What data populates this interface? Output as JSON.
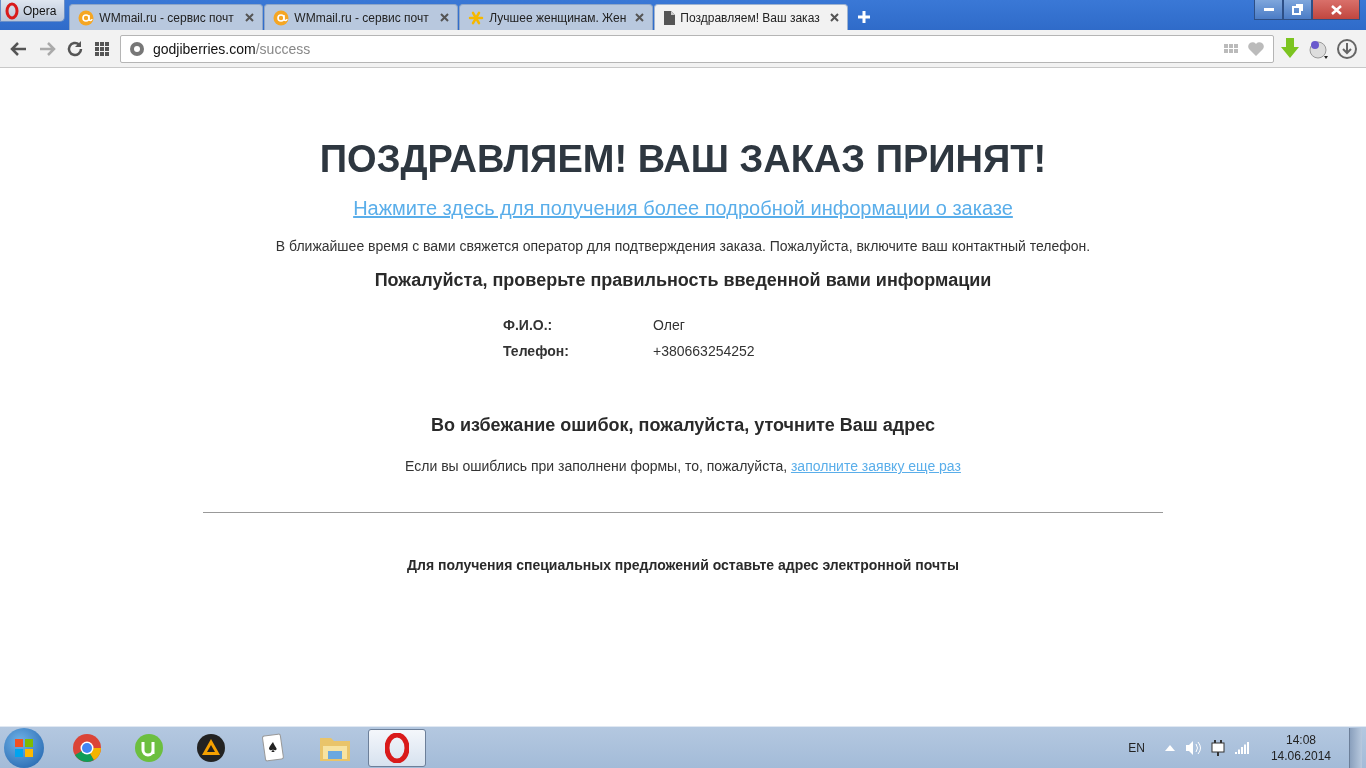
{
  "browser": {
    "menu_button": "Opera",
    "tabs": [
      {
        "title": "WMmail.ru - сервис почт",
        "kind": "mail",
        "selected": false
      },
      {
        "title": "WMmail.ru - сервис почт",
        "kind": "mail",
        "selected": false
      },
      {
        "title": "Лучшее женщинам. Жен",
        "kind": "star",
        "selected": false
      },
      {
        "title": "Поздравляем! Ваш заказ",
        "kind": "page",
        "selected": true
      }
    ],
    "address": {
      "host": "godjiberries.com",
      "path": "/success"
    }
  },
  "page": {
    "heading": "ПОЗДРАВЛЯЕМ! ВАШ ЗАКАЗ ПРИНЯТ!",
    "details_link": "Нажмите здесь для получения более подробной информации о заказе",
    "notice": "В ближайшее время с вами свяжется оператор для подтверждения заказа. Пожалуйста, включите ваш контактный телефон.",
    "check_heading": "Пожалуйста, проверьте правильность введенной вами информации",
    "fields": [
      {
        "label": "Ф.И.О.:",
        "value": "Олег"
      },
      {
        "label": "Телефон:",
        "value": "+380663254252"
      }
    ],
    "address_heading": "Во избежание ошибок, пожалуйста, уточните Ваш адрес",
    "retry": {
      "text": "Если вы ошиблись при заполнени формы, то, пожалуйста, ",
      "link": "заполните заявку еще раз"
    },
    "email_heading": "Для получения специальных предложений оставьте адрес электронной почты"
  },
  "taskbar": {
    "apps": [
      {
        "kind": "chrome",
        "selected": false
      },
      {
        "kind": "torrent",
        "selected": false
      },
      {
        "kind": "player",
        "selected": false
      },
      {
        "kind": "cards",
        "selected": false
      },
      {
        "kind": "folder",
        "selected": false
      },
      {
        "kind": "opera",
        "selected": true
      }
    ],
    "language": "EN",
    "time": "14:08",
    "date": "14.06.2014"
  }
}
